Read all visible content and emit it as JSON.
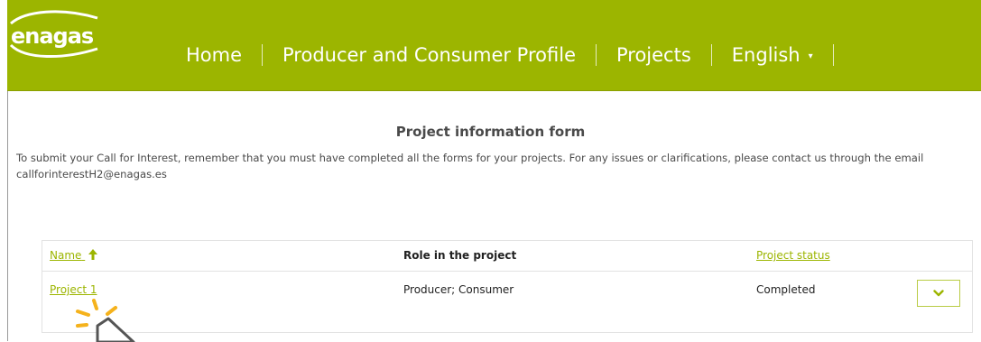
{
  "brand": {
    "logo_text": "enagas",
    "accent": "#9cb500"
  },
  "nav": {
    "items": [
      "Home",
      "Producer and Consumer Profile",
      "Projects",
      "English"
    ]
  },
  "form": {
    "title": "Project information form",
    "intro": "To submit your Call for Interest, remember that you must have completed all the forms for your projects. For any issues or clarifications, please contact us through the email callforinterestH2@enagas.es"
  },
  "table": {
    "headers": {
      "name": "Name",
      "role": "Role in the project",
      "status": "Project status"
    },
    "rows": [
      {
        "name": "Project 1",
        "role": "Producer; Consumer",
        "status": "Completed"
      }
    ]
  },
  "icons": {
    "sort": "arrow-up-icon",
    "dropdown": "chevron-down-icon",
    "cursor": "mouse-pointer-icon"
  }
}
